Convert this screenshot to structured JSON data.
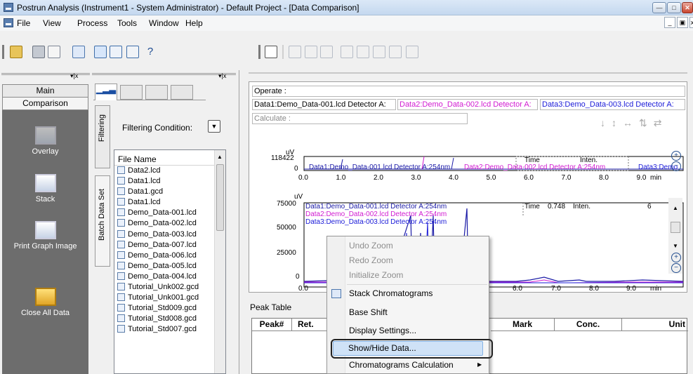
{
  "window": {
    "title": "Postrun Analysis (Instrument1 - System Administrator) - Default Project - [Data Comparison]"
  },
  "menu": [
    "File",
    "View",
    "Process",
    "Tools",
    "Window",
    "Help"
  ],
  "nav": {
    "tabs": [
      "Main",
      "Comparison"
    ],
    "items": [
      "Overlay",
      "Stack",
      "Print Graph Image",
      "Close All Data"
    ]
  },
  "filter": {
    "vertical_tabs": [
      "Filtering",
      "Batch Data Set"
    ],
    "condition_label": "Filtering Condition:",
    "list_header": "File Name",
    "files": [
      "Data2.lcd",
      "Data1.lcd",
      "Data1.gcd",
      "Data1.lcd",
      "Demo_Data-001.lcd",
      "Demo_Data-002.lcd",
      "Demo_Data-003.lcd",
      "Demo_Data-007.lcd",
      "Demo_Data-006.lcd",
      "Demo_Data-005.lcd",
      "Demo_Data-004.lcd",
      "Tutorial_Unk002.gcd",
      "Tutorial_Unk001.gcd",
      "Tutorial_Std009.gcd",
      "Tutorial_Std008.gcd",
      "Tutorial_Std007.gcd"
    ]
  },
  "comparison": {
    "operate_label": "Operate :",
    "data_chips": [
      "Data1:Demo_Data-001.lcd Detector A:",
      "Data2:Demo_Data-002.lcd Detector A:",
      "Data3:Demo_Data-003.lcd Detector A:"
    ],
    "calculate_label": "Calculate :"
  },
  "chart_top": {
    "unit": "uV",
    "ymax": "118422",
    "yzero": "0",
    "xticks": [
      "0.0",
      "1.0",
      "2.0",
      "3.0",
      "4.0",
      "5.0",
      "6.0",
      "7.0",
      "8.0",
      "9.0"
    ],
    "xunit": "min",
    "time_label": "Time",
    "inten_label": "Inten.",
    "legend_inline": [
      "Data1:Demo_Data-001.lcd Detector A:254nm",
      "Data2:Demo_Data-002.lcd Detector A:254nm",
      "Data3:Demo"
    ]
  },
  "chart_bottom": {
    "unit": "uV",
    "yticks": [
      "75000",
      "50000",
      "25000",
      "0"
    ],
    "xticks": [
      "0.0",
      "6.0",
      "7.0",
      "8.0",
      "9.0"
    ],
    "xunit": "min",
    "time_label": "Time",
    "time_value": "0.748",
    "inten_label": "Inten.",
    "inten_value": "6",
    "legend": [
      {
        "text": "Data1:Demo_Data-001.lcd Detector A:254nm",
        "color": "#1a1aa6"
      },
      {
        "text": "Data2:Demo_Data-002.lcd Detector A:254nm",
        "color": "#d11ad1"
      },
      {
        "text": "Data3:Demo_Data-003.lcd Detector A:254nm",
        "color": "#1a1ad8"
      }
    ]
  },
  "peak_table": {
    "title": "Peak Table",
    "columns": [
      "Peak#",
      "Ret.",
      "Mark",
      "Conc.",
      "Unit"
    ]
  },
  "context_menu": {
    "items": [
      {
        "label": "Undo Zoom",
        "enabled": false
      },
      {
        "label": "Redo Zoom",
        "enabled": false
      },
      {
        "label": "Initialize Zoom",
        "enabled": false
      },
      {
        "label": "Stack Chromatograms",
        "enabled": true
      },
      {
        "label": "Base Shift",
        "enabled": true
      },
      {
        "label": "Display Settings...",
        "enabled": true
      },
      {
        "label": "Show/Hide Data...",
        "enabled": true
      },
      {
        "label": "Chromatograms Calculation",
        "enabled": true
      }
    ],
    "highlighted": "Show/Hide Data..."
  },
  "colors": {
    "data1": "#1a1aa6",
    "data2": "#d11ad1",
    "data3": "#1a1ad8",
    "nav_bg": "#6d6d6d",
    "highlight": "#cfe2f7"
  }
}
